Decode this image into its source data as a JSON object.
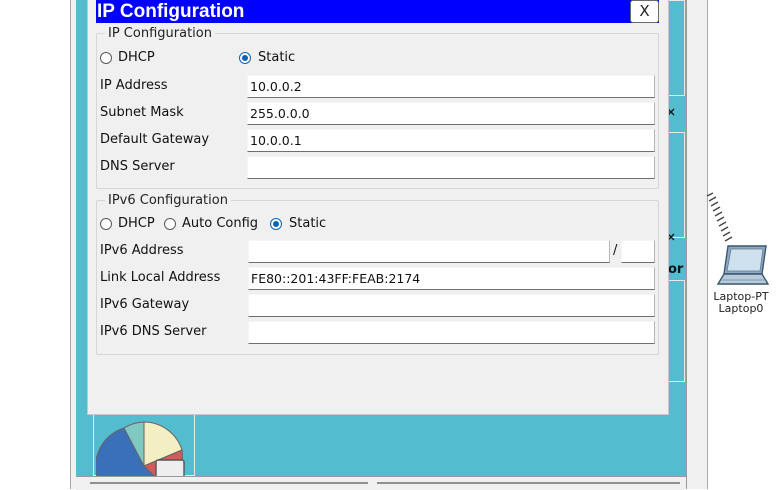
{
  "dialog": {
    "title": "IP Configuration",
    "close_label": "X"
  },
  "ipv4": {
    "legend": "IP Configuration",
    "dhcp_label": "DHCP",
    "static_label": "Static",
    "selected_mode": "Static",
    "ip_address_label": "IP Address",
    "ip_address_value": "10.0.0.2",
    "subnet_mask_label": "Subnet Mask",
    "subnet_mask_value": "255.0.0.0",
    "default_gateway_label": "Default Gateway",
    "default_gateway_value": "10.0.0.1",
    "dns_server_label": "DNS Server",
    "dns_server_value": ""
  },
  "ipv6": {
    "legend": "IPv6 Configuration",
    "dhcp_label": "DHCP",
    "auto_config_label": "Auto Config",
    "static_label": "Static",
    "selected_mode": "Static",
    "address_label": "IPv6 Address",
    "address_value": "",
    "prefix_separator": "/",
    "prefix_value": "",
    "link_local_label": "Link Local Address",
    "link_local_value": "FE80::201:43FF:FEAB:2174",
    "gateway_label": "IPv6 Gateway",
    "gateway_value": "",
    "dns_server_label": "IPv6 DNS Server",
    "dns_server_value": ""
  },
  "background": {
    "partial_label": "or",
    "laptop_type": "Laptop-PT",
    "laptop_name": "Laptop0"
  },
  "icons": [
    "close-icon",
    "laptop-icon",
    "pie-chart-icon",
    "wireless-signal-icon"
  ],
  "colors": {
    "title_bar": "#0000ff",
    "workspace": "#54bccf",
    "radio_selected": "#0a64b4"
  }
}
